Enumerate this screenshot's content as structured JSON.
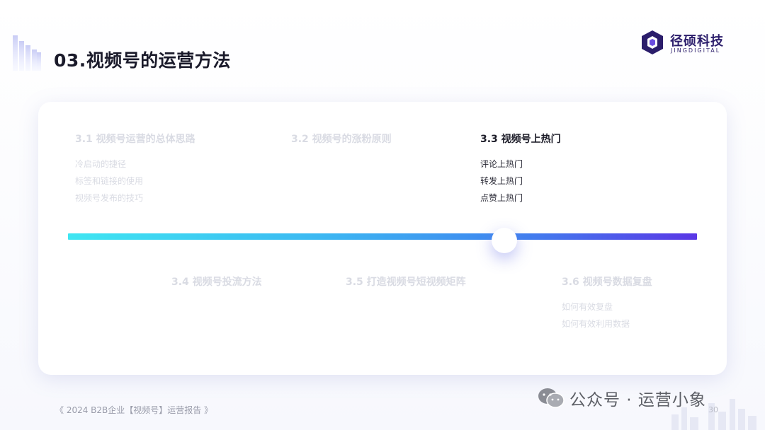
{
  "header": {
    "title": "03.视频号的运营方法"
  },
  "logo": {
    "cn": "径硕科技",
    "en": "JINGDIGITAL"
  },
  "sections": [
    {
      "title": "3.1 视频号运营的总体思路",
      "items": [
        "冷启动的捷径",
        "标签和链接的使用",
        "视频号发布的技巧"
      ],
      "active": false
    },
    {
      "title": "3.2 视频号的涨粉原则",
      "items": [],
      "active": false
    },
    {
      "title": "3.3 视频号上热门",
      "items": [
        "评论上热门",
        "转发上热门",
        "点赞上热门"
      ],
      "active": true
    },
    {
      "title": "3.4 视频号投流方法",
      "items": [],
      "active": false
    },
    {
      "title": "3.5 打造视频号短视频矩阵",
      "items": [],
      "active": false
    },
    {
      "title": "3.6 视频号数据复盘",
      "items": [
        "如何有效复盘",
        "如何有效利用数据"
      ],
      "active": false
    }
  ],
  "footer": {
    "report": "《 2024 B2B企业【视频号】运营报告 》",
    "page": "30"
  },
  "watermark": {
    "text": "公众号 · 运营小象"
  },
  "colors": {
    "timeline_start": "#3fe6f2",
    "timeline_end": "#5a37e6",
    "brand": "#2b1d6b",
    "active_text": "#1c1c28",
    "inactive_text": "#d9dbe3"
  }
}
